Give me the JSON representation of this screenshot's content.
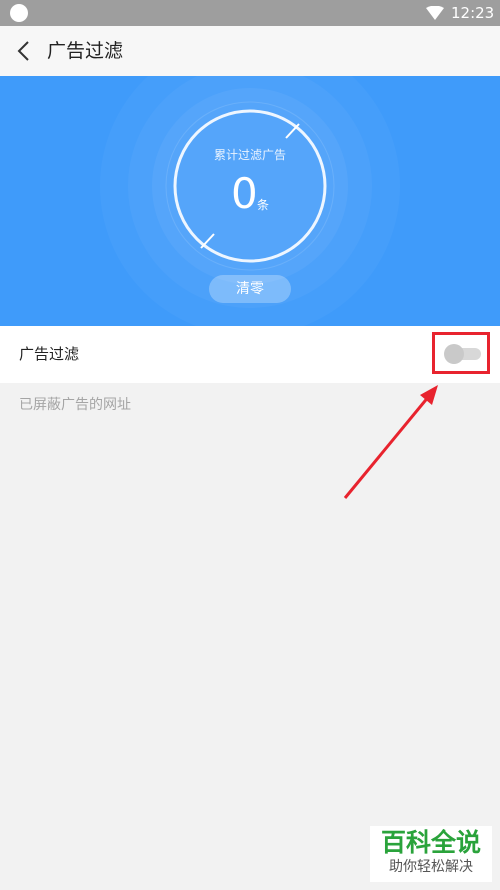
{
  "status_bar": {
    "time": "12:23"
  },
  "header": {
    "title": "广告过滤",
    "back_icon": "chevron-left-icon"
  },
  "hero": {
    "label": "累计过滤广告",
    "count": "0",
    "unit": "条",
    "reset_label": "清零",
    "color": "#3f9bfa"
  },
  "filter_row": {
    "label": "广告过滤",
    "toggle_on": false
  },
  "blocked_section": {
    "title": "已屏蔽广告的网址"
  },
  "annotation": {
    "color": "#e8232e"
  },
  "watermark": {
    "title": "百科全说",
    "subtitle": "助你轻松解决"
  }
}
